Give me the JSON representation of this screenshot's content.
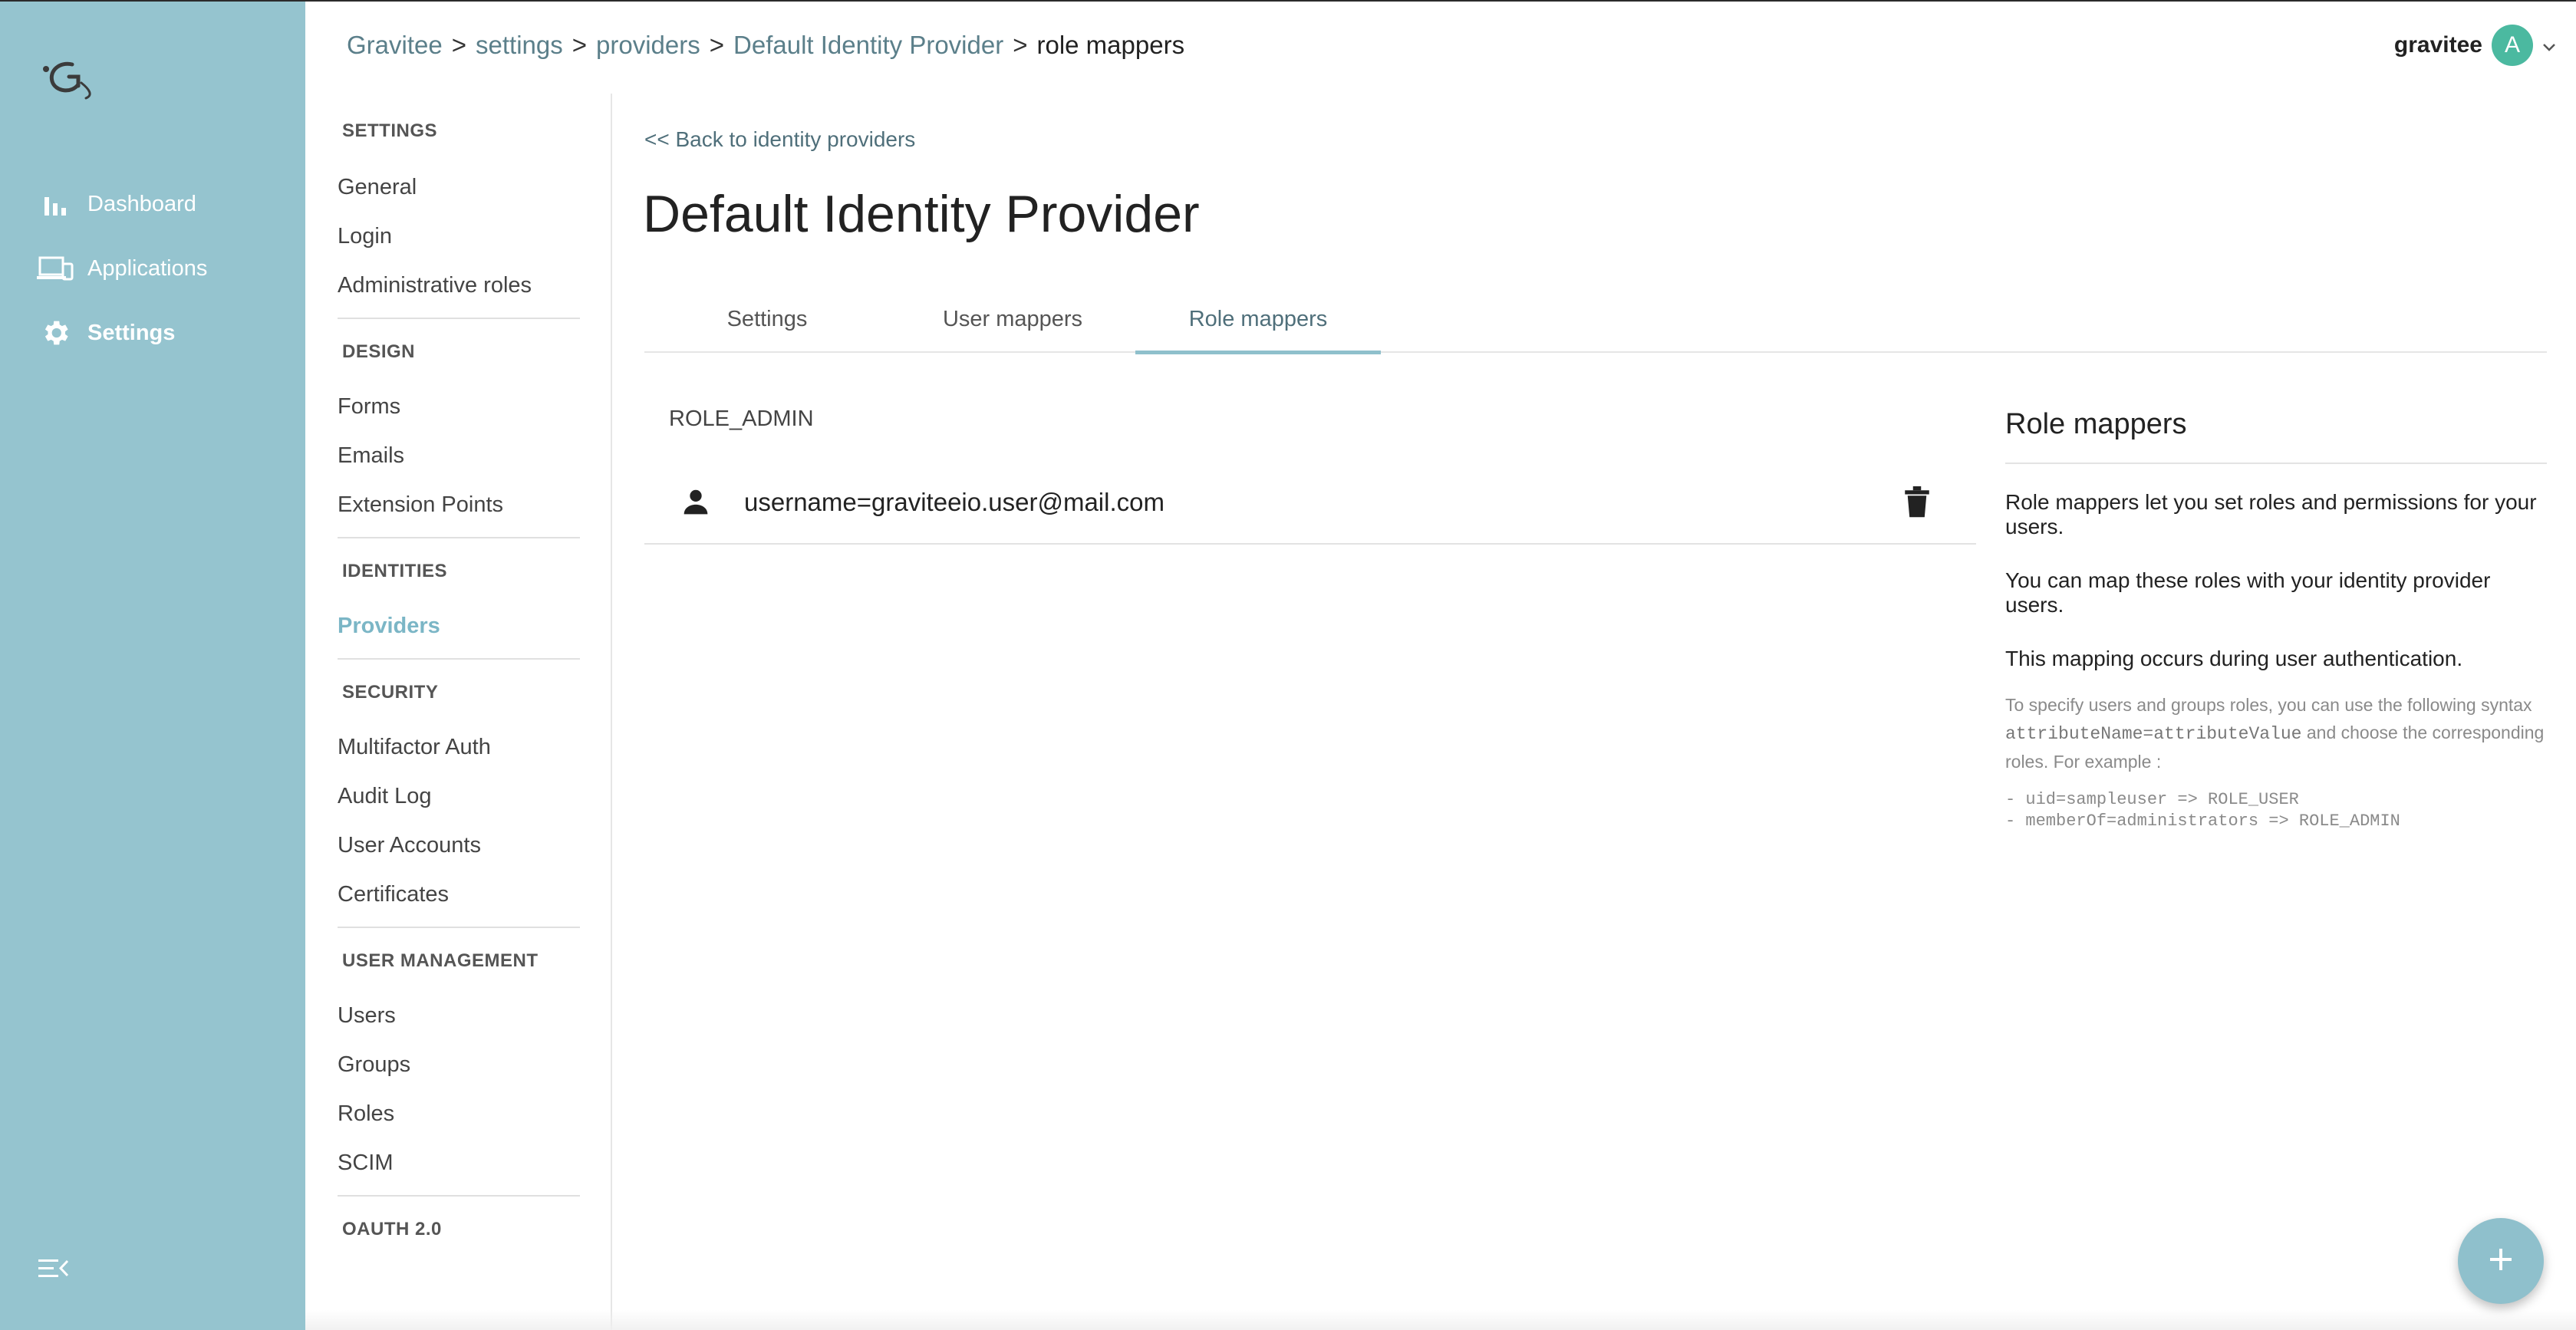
{
  "breadcrumb": {
    "items": [
      "Gravitee",
      "settings",
      "providers",
      "Default Identity Provider"
    ],
    "current": "role mappers",
    "separator": ">"
  },
  "user": {
    "name": "gravitee",
    "initial": "A"
  },
  "rail": {
    "items": [
      {
        "label": "Dashboard",
        "icon": "bar-chart-icon"
      },
      {
        "label": "Applications",
        "icon": "devices-icon"
      },
      {
        "label": "Settings",
        "icon": "gear-icon"
      }
    ]
  },
  "subnav": {
    "groups": [
      {
        "title": "SETTINGS",
        "items": [
          "General",
          "Login",
          "Administrative roles"
        ]
      },
      {
        "title": "DESIGN",
        "items": [
          "Forms",
          "Emails",
          "Extension Points"
        ]
      },
      {
        "title": "IDENTITIES",
        "items": [
          "Providers"
        ]
      },
      {
        "title": "SECURITY",
        "items": [
          "Multifactor Auth",
          "Audit Log",
          "User Accounts",
          "Certificates"
        ]
      },
      {
        "title": "USER MANAGEMENT",
        "items": [
          "Users",
          "Groups",
          "Roles",
          "SCIM"
        ]
      },
      {
        "title": "OAUTH 2.0",
        "items": []
      }
    ]
  },
  "main": {
    "back_link": "<< Back to identity providers",
    "title": "Default Identity Provider",
    "tabs": [
      "Settings",
      "User mappers",
      "Role mappers"
    ],
    "role": "ROLE_ADMIN",
    "mapper": "username=graviteeio.user@mail.com"
  },
  "help": {
    "title": "Role mappers",
    "p1": "Role mappers let you set roles and permissions for your users.",
    "p2": "You can map these roles with your identity provider users.",
    "p3": "This mapping occurs during user authentication.",
    "small_pre": "To specify users and groups roles, you can use the following syntax",
    "small_code": "attributeName=attributeValue",
    "small_post": "and choose the corresponding roles. For example :",
    "example1": "- uid=sampleuser => ROLE_USER",
    "example2": "- memberOf=administrators => ROLE_ADMIN"
  },
  "colors": {
    "rail": "#95c4cf",
    "accent": "#8fc0cc",
    "active_subnav": "#7bb6c6",
    "avatar": "#4bb9a0"
  }
}
